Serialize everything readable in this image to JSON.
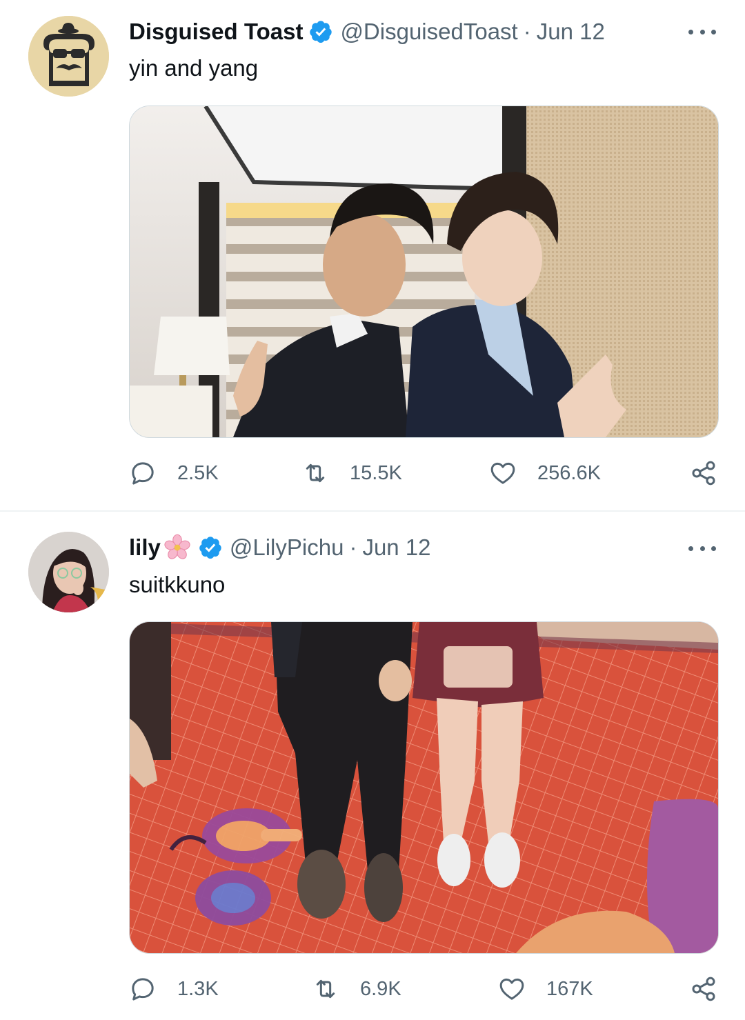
{
  "tweets": [
    {
      "display_name": "Disguised Toast",
      "handle": "@DisguisedToast",
      "separator": "·",
      "date": "Jun 12",
      "text": "yin and yang",
      "avatar_icon": "toast-mustache-avatar",
      "stats": {
        "replies": "2.5K",
        "retweets": "15.5K",
        "likes": "256.6K"
      }
    },
    {
      "display_name": "lily",
      "handle": "@LilyPichu",
      "separator": "·",
      "date": "Jun 12",
      "text": "suitkkuno",
      "avatar_icon": "lily-avatar",
      "stats": {
        "replies": "1.3K",
        "retweets": "6.9K",
        "likes": "167K"
      }
    }
  ],
  "colors": {
    "verified": "#1d9bf0",
    "secondary_text": "#536471",
    "primary_text": "#0f1419",
    "divider": "#eff3f4"
  }
}
